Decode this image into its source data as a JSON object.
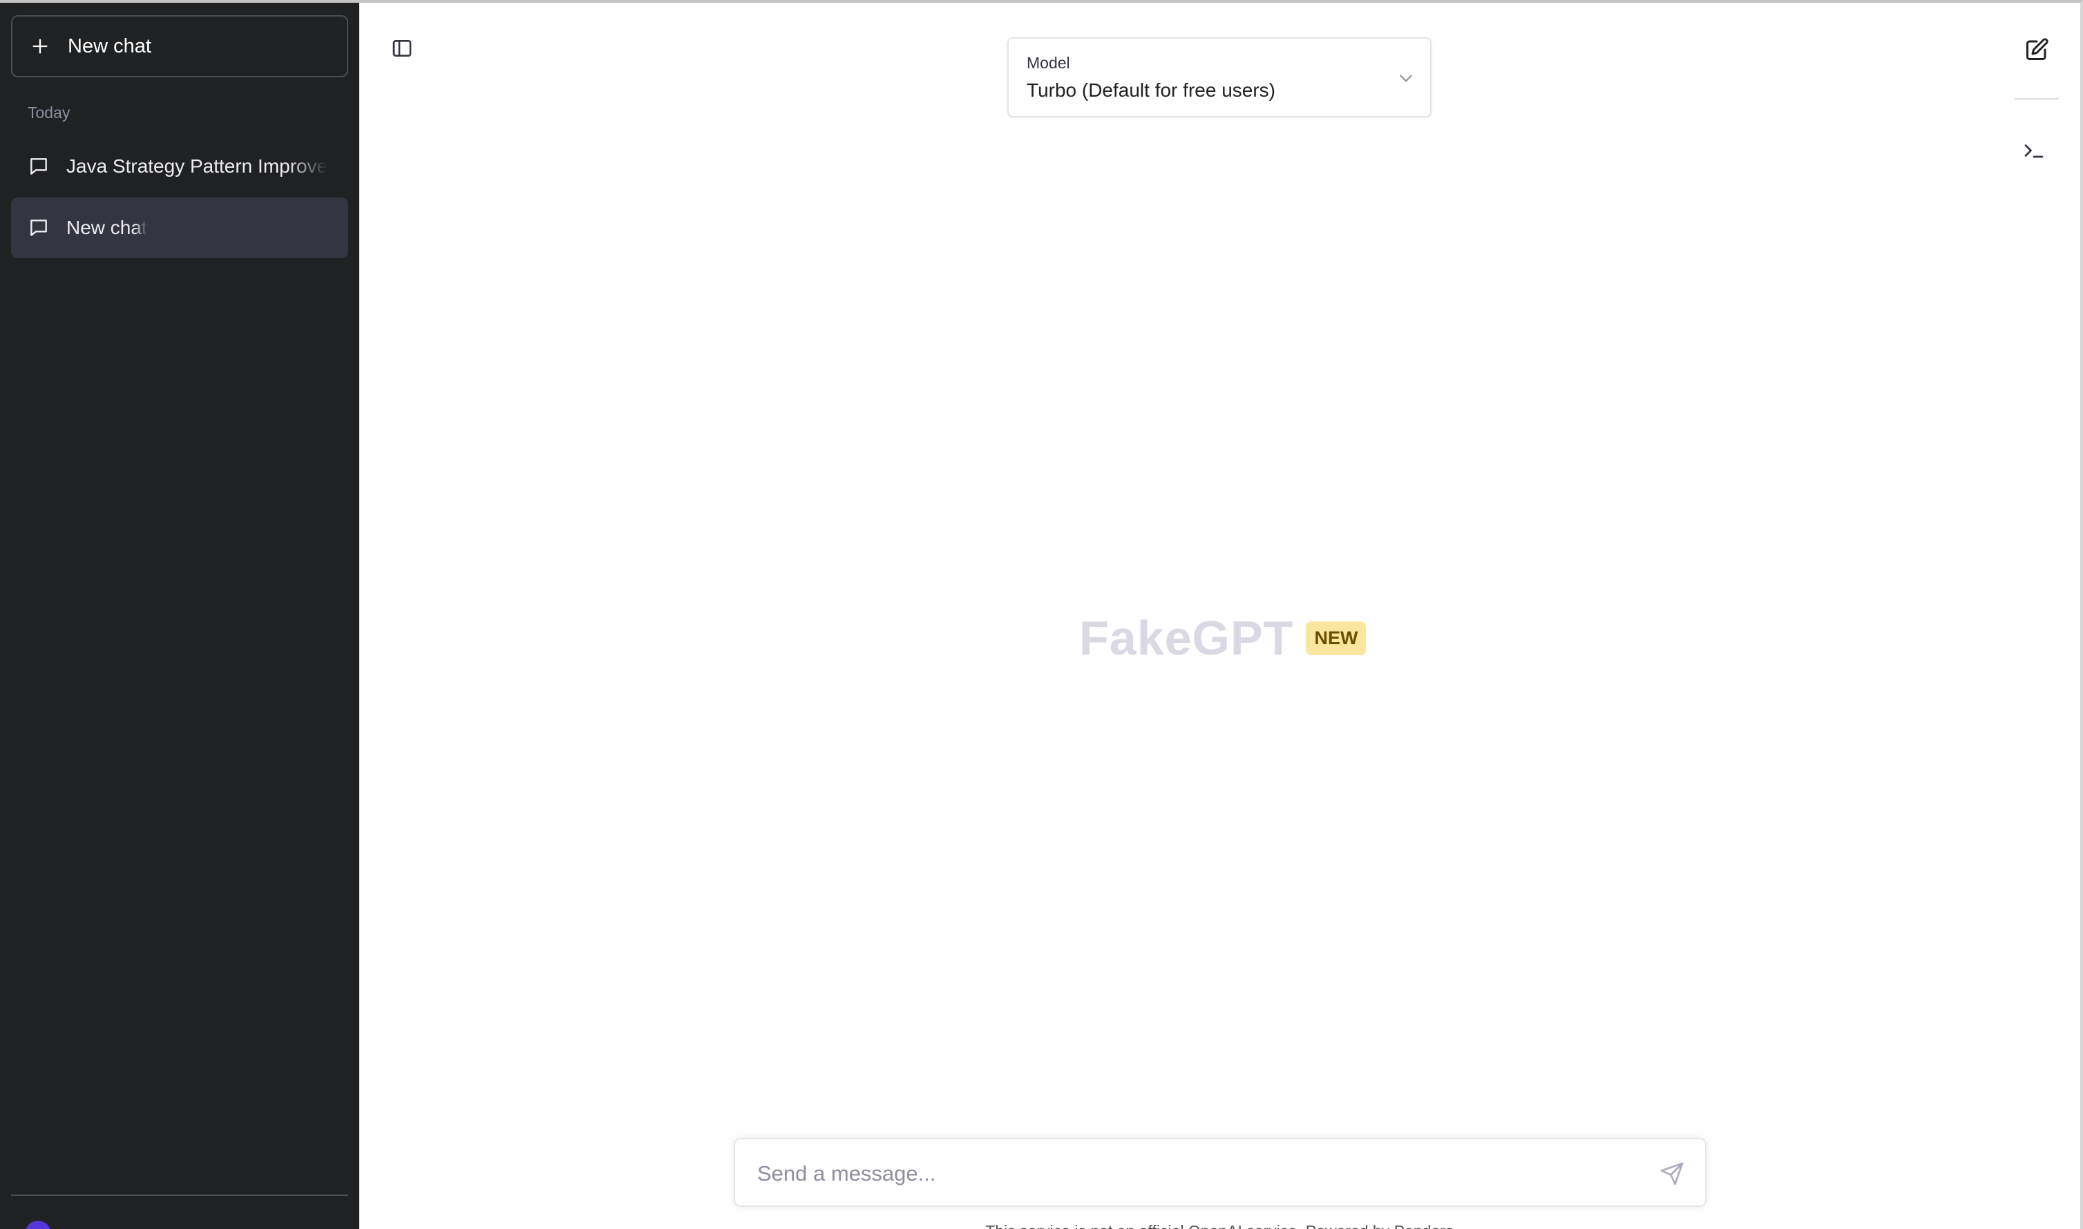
{
  "sidebar": {
    "new_chat_label": "New chat",
    "section_today": "Today",
    "conversations": [
      {
        "title": "Java Strategy Pattern Improve",
        "active": false
      },
      {
        "title": "New chat",
        "active": true
      }
    ],
    "user": {
      "name": ""
    }
  },
  "header": {
    "model": {
      "caption": "Model",
      "selected": "Turbo (Default for free users)"
    }
  },
  "main": {
    "brand_name": "FakeGPT",
    "badge": "NEW"
  },
  "composer": {
    "placeholder": "Send a message...",
    "value": ""
  },
  "footer": {
    "note": "This service is not an official OpenAI service. Powered by Pandora"
  },
  "icons": {
    "new_chat": "plus-icon",
    "conversation": "chat-bubble-icon",
    "toggle_sidebar": "sidebar-toggle-icon",
    "model_dropdown": "chevron-down-icon",
    "edit": "edit-icon",
    "terminal": "terminal-icon",
    "send": "send-icon"
  },
  "colors": {
    "sidebar_bg": "#202123",
    "active_item_bg": "#343541",
    "badge_bg": "#fae69e",
    "brand_text": "#d9d9e3",
    "avatar": "#5436da"
  }
}
